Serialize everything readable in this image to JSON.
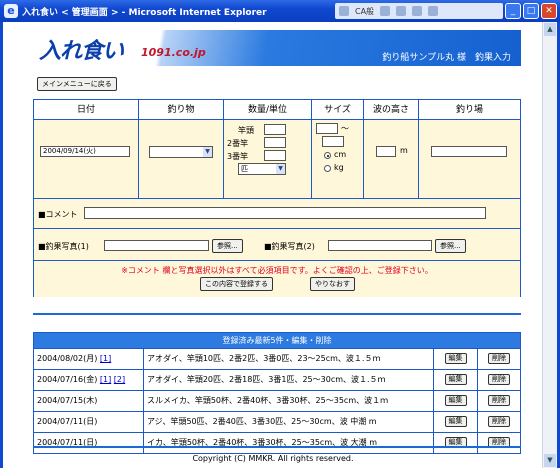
{
  "window": {
    "title": "入れ食い < 管理画面 > - Microsoft Internet Explorer",
    "tray_label": "CA般"
  },
  "banner": {
    "logo": "入れ食い",
    "domain": "1091.co.jp",
    "user_text": "釣り船サンプル丸 様　釣果入力"
  },
  "menu_button": "メインメニューに戻る",
  "form": {
    "headers": [
      "日付",
      "釣り物",
      "数量/単位",
      "サイズ",
      "波の高さ",
      "釣り場"
    ],
    "date_value": "2004/09/14(火)",
    "qty_labels": [
      "竿頭",
      "2番竿",
      "3番竿"
    ],
    "unit_select": "匹",
    "size_sep": "〜",
    "unit_cm": "cm",
    "unit_kg": "kg",
    "wave_unit": "m",
    "comment_label": "■コメント",
    "photo1_label": "■釣果写真(1)",
    "photo2_label": "■釣果写真(2)",
    "browse_label": "参照...",
    "notice": "※コメント 欄と写真選択以外はすべて必須項目です。よくご確認の上、ご登録下さい。",
    "submit_label": "この内容で登録する",
    "reset_label": "やりなおす"
  },
  "records": {
    "title": "登録済み最新5件・編集・削除",
    "edit_label": "編集",
    "delete_label": "削除",
    "rows": [
      {
        "date": "2004/08/02(月)",
        "links": [
          "[1]"
        ],
        "text": "アオダイ、竿頭10匹、2番2匹、3番0匹、23〜25cm、波１.５ｍ"
      },
      {
        "date": "2004/07/16(金)",
        "links": [
          "[1]",
          "[2]"
        ],
        "text": "アオダイ、竿頭20匹、2番18匹、3番1匹、25〜30cm、波１.５ｍ"
      },
      {
        "date": "2004/07/15(木)",
        "links": [],
        "text": "スルメイカ、竿頭50杯、2番40杯、3番30杯、25〜35cm、波１ｍ"
      },
      {
        "date": "2004/07/11(日)",
        "links": [],
        "text": "アジ、竿頭50匹、2番40匹、3番30匹、25〜30cm、波 中潮 m"
      },
      {
        "date": "2004/07/11(日)",
        "links": [],
        "text": "イカ、竿頭50杯、2番40杯、3番30杯、25〜35cm、波 大潮 m"
      }
    ]
  },
  "footer": "Copyright (C) MMKR. All rights reserved."
}
